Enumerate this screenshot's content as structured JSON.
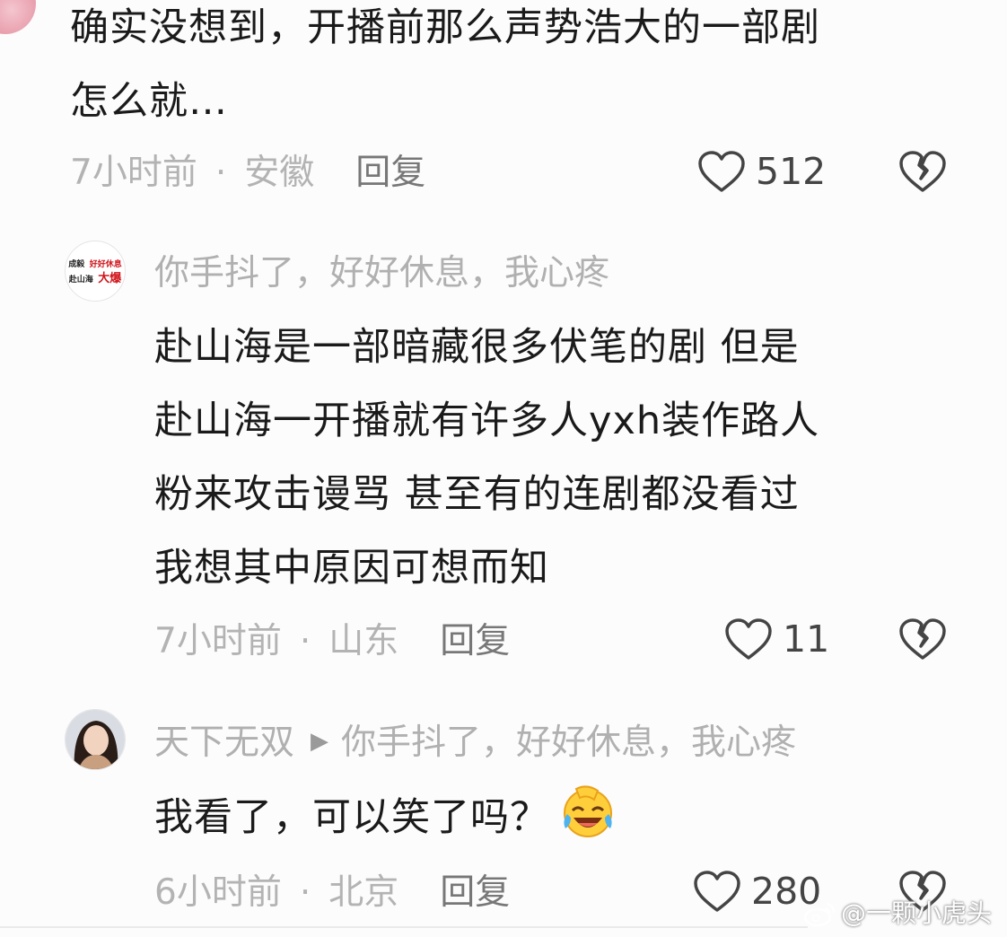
{
  "comments": [
    {
      "text_lines": [
        "确实没想到，开播前那么声势浩大的一部剧",
        "怎么就…"
      ],
      "time": "7小时前",
      "location": "安徽",
      "reply_label": "回复",
      "likes": "512"
    },
    {
      "username": "你手抖了，好好休息，我心疼",
      "avatar_logo": {
        "line1a": "成毅",
        "line1b": "好好休息",
        "line2a": "赴山海",
        "line2b": "大爆"
      },
      "text_lines": [
        "赴山海是一部暗藏很多伏笔的剧 但是",
        "赴山海一开播就有许多人yxh装作路人",
        "粉来攻击谩骂 甚至有的连剧都没看过",
        "我想其中原因可想而知"
      ],
      "time": "7小时前",
      "location": "山东",
      "reply_label": "回复",
      "likes": "11"
    },
    {
      "username": "天下无双",
      "reply_to": "你手抖了，好好休息，我心疼",
      "text": "我看了，可以笑了吗？",
      "emoji": "laughing-crying-emoji",
      "time": "6小时前",
      "location": "北京",
      "reply_label": "回复",
      "likes": "280"
    }
  ],
  "separator": "·",
  "watermark": "@一颗小虎头",
  "colors": {
    "text": "#1a1a1a",
    "meta": "#b3b3b3",
    "reply": "#777777",
    "icon": "#444444"
  }
}
